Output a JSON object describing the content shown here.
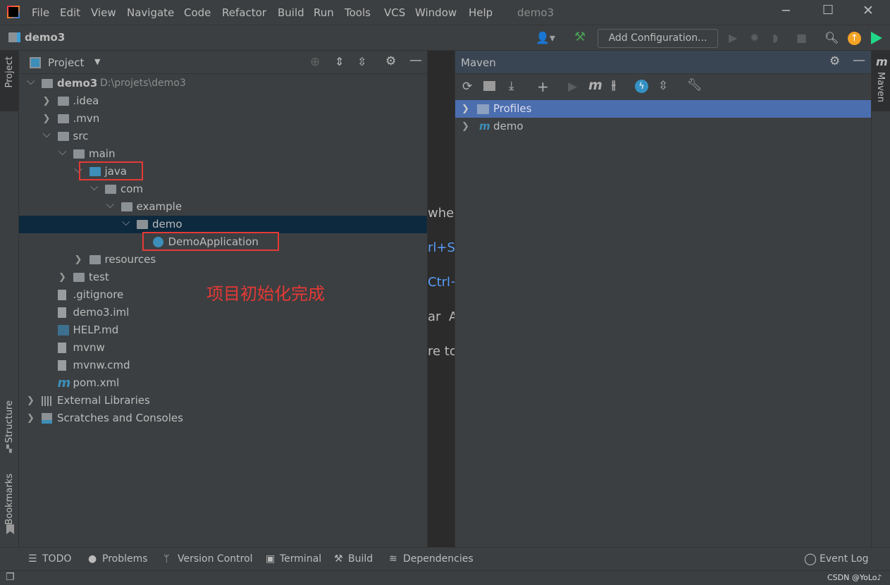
{
  "titlebar": {
    "menu": [
      "File",
      "Edit",
      "View",
      "Navigate",
      "Code",
      "Refactor",
      "Build",
      "Run",
      "Tools",
      "VCS",
      "Window",
      "Help"
    ],
    "project_title": "demo3"
  },
  "toolbar": {
    "project_name": "demo3",
    "add_config": "Add Configuration..."
  },
  "left_strip": {
    "project": "Project",
    "structure": "Structure",
    "bookmarks": "Bookmarks"
  },
  "right_strip": {
    "maven": "Maven"
  },
  "project_panel": {
    "title": "Project",
    "tree": [
      {
        "label": "demo3",
        "path": "D:\\projets\\demo3",
        "level": 0,
        "state": "expanded",
        "icon": "module-folder",
        "bold": true
      },
      {
        "label": ".idea",
        "level": 1,
        "state": "collapsed",
        "icon": "folder"
      },
      {
        "label": ".mvn",
        "level": 1,
        "state": "collapsed",
        "icon": "folder"
      },
      {
        "label": "src",
        "level": 1,
        "state": "expanded",
        "icon": "folder"
      },
      {
        "label": "main",
        "level": 2,
        "state": "expanded",
        "icon": "folder"
      },
      {
        "label": "java",
        "level": 3,
        "state": "expanded",
        "icon": "source-folder",
        "highlight": true
      },
      {
        "label": "com",
        "level": 4,
        "state": "expanded",
        "icon": "package"
      },
      {
        "label": "example",
        "level": 5,
        "state": "expanded",
        "icon": "package"
      },
      {
        "label": "demo",
        "level": 6,
        "state": "expanded",
        "icon": "package",
        "selected": true
      },
      {
        "label": "DemoApplication",
        "level": 7,
        "state": "leaf",
        "icon": "spring-class",
        "highlight": true
      },
      {
        "label": "resources",
        "level": 3,
        "state": "collapsed",
        "icon": "resources-folder"
      },
      {
        "label": "test",
        "level": 2,
        "state": "collapsed",
        "icon": "folder"
      },
      {
        "label": ".gitignore",
        "level": 1,
        "state": "leaf",
        "icon": "ignore-file"
      },
      {
        "label": "demo3.iml",
        "level": 1,
        "state": "leaf",
        "icon": "iml-file"
      },
      {
        "label": "HELP.md",
        "level": 1,
        "state": "leaf",
        "icon": "markdown-file"
      },
      {
        "label": "mvnw",
        "level": 1,
        "state": "leaf",
        "icon": "shell-file"
      },
      {
        "label": "mvnw.cmd",
        "level": 1,
        "state": "leaf",
        "icon": "file"
      },
      {
        "label": "pom.xml",
        "level": 1,
        "state": "leaf",
        "icon": "maven-file"
      },
      {
        "label": "External Libraries",
        "level": 0,
        "state": "collapsed",
        "icon": "libraries"
      },
      {
        "label": "Scratches and Consoles",
        "level": 0,
        "state": "collapsed",
        "icon": "scratches"
      }
    ],
    "annotation": "项目初始化完成",
    "annotation_color": "#e53935"
  },
  "editor": {
    "fragments": [
      "wher",
      "rl+S",
      "Ctrl+",
      "ar  A",
      "re to"
    ]
  },
  "maven_panel": {
    "title": "Maven",
    "tree": [
      {
        "label": "Profiles",
        "selected": true
      },
      {
        "label": "demo"
      }
    ]
  },
  "bottom_tabs": [
    "TODO",
    "Problems",
    "Version Control",
    "Terminal",
    "Build",
    "Dependencies"
  ],
  "event_log": "Event Log",
  "watermark": "CSDN @YoLo♪",
  "colors": {
    "selection": "#0d293e",
    "maven_selection": "#4b6eaf",
    "accent": "#3d8eb9"
  }
}
